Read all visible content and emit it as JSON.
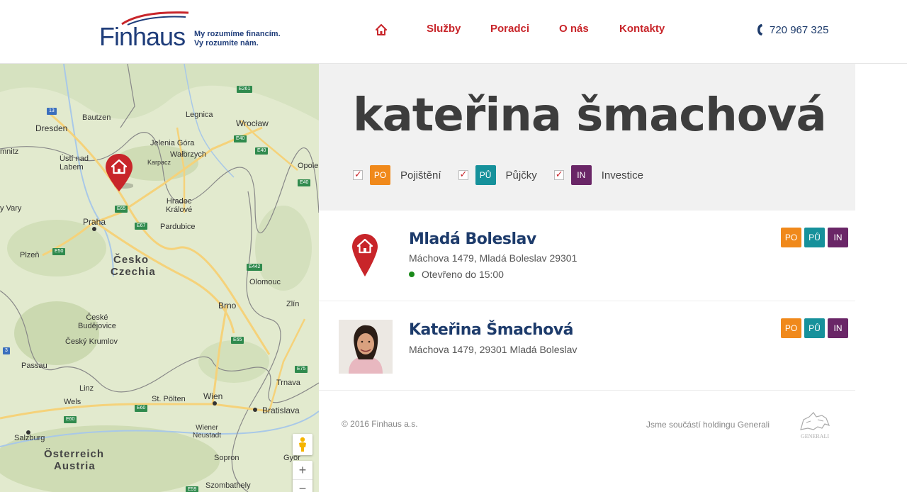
{
  "header": {
    "logo_text": "Finhaus",
    "tagline_1": "My rozumíme financím.",
    "tagline_2": "Vy rozumíte nám.",
    "nav": [
      {
        "label": "Služby"
      },
      {
        "label": "Poradci"
      },
      {
        "label": "O nás"
      },
      {
        "label": "Kontakty"
      }
    ],
    "home_icon": "home-icon",
    "phone_icon": "phone-icon",
    "phone": "720 967 325",
    "brand_color": "#c8252a",
    "navy_color": "#1d3b6b"
  },
  "map": {
    "labels": {
      "dresden": "Dresden",
      "bautzen": "Bautzen",
      "legnica": "Legnica",
      "wroclaw": "Wrocław",
      "mnitz": "mnitz",
      "jelenia": "Jelenia Góra",
      "walbrzych": "Wałbrzych",
      "usti": "Ústí nad\nLabem",
      "karpacz": "Karpacz",
      "opole": "Opole",
      "vary": "y Vary",
      "hradec": "Hradec\nKrálové",
      "praha": "Praha",
      "pardubice": "Pardubice",
      "plzen": "Plzeň",
      "cesko": "Česko",
      "czechia": "Czechia",
      "olomouc": "Olomouc",
      "ceske_bud": "České\nBudějovice",
      "brno": "Brno",
      "zlin": "Zlín",
      "cesky_krumlov": "Český Krumlov",
      "passau": "Passau",
      "trnava": "Trnava",
      "linz": "Linz",
      "wels": "Wels",
      "st_polten": "St. Pölten",
      "wien": "Wien",
      "bratislava": "Bratislava",
      "wiener_neustadt": "Wiener\nNeustadt",
      "salzburg": "Salzburg",
      "osterreich": "Österreich",
      "austria": "Austria",
      "sopron": "Sopron",
      "gyor": "Győr",
      "szombathely": "Szombathely"
    },
    "roads": {
      "e261": "E261",
      "r13": "13",
      "e40a": "E40",
      "e40b": "E40",
      "e40c": "E40",
      "e65a": "E65",
      "e67": "E67",
      "e50": "E50",
      "e442": "E442",
      "e65b": "E65",
      "e75": "E75",
      "e60a": "E60",
      "e60b": "E60",
      "r3": "3",
      "e59": "E59"
    },
    "zoom_in": "+",
    "zoom_out": "−"
  },
  "advisor": {
    "name_heading": "kateřina šmachová",
    "filters": [
      {
        "code": "PO",
        "label": "Pojištění",
        "color": "#f0891b",
        "checked": true
      },
      {
        "code": "PŮ",
        "label": "Půjčky",
        "color": "#16919b",
        "checked": true
      },
      {
        "code": "IN",
        "label": "Investice",
        "color": "#6a2667",
        "checked": true
      }
    ]
  },
  "results": [
    {
      "title": "Mladá Boleslav",
      "address": "Máchova 1479, Mladá Boleslav 29301",
      "opening": "Otevřeno do 15:00",
      "tags": [
        "PO",
        "PŮ",
        "IN"
      ]
    },
    {
      "title": "Kateřina Šmachová",
      "address": "Máchova 1479, 29301 Mladá Boleslav",
      "tags": [
        "PO",
        "PŮ",
        "IN"
      ]
    }
  ],
  "footer": {
    "copyright": "© 2016 Finhaus a.s.",
    "generali_text": "Jsme součástí holdingu Generali",
    "generali_logo": "GENERALI"
  }
}
